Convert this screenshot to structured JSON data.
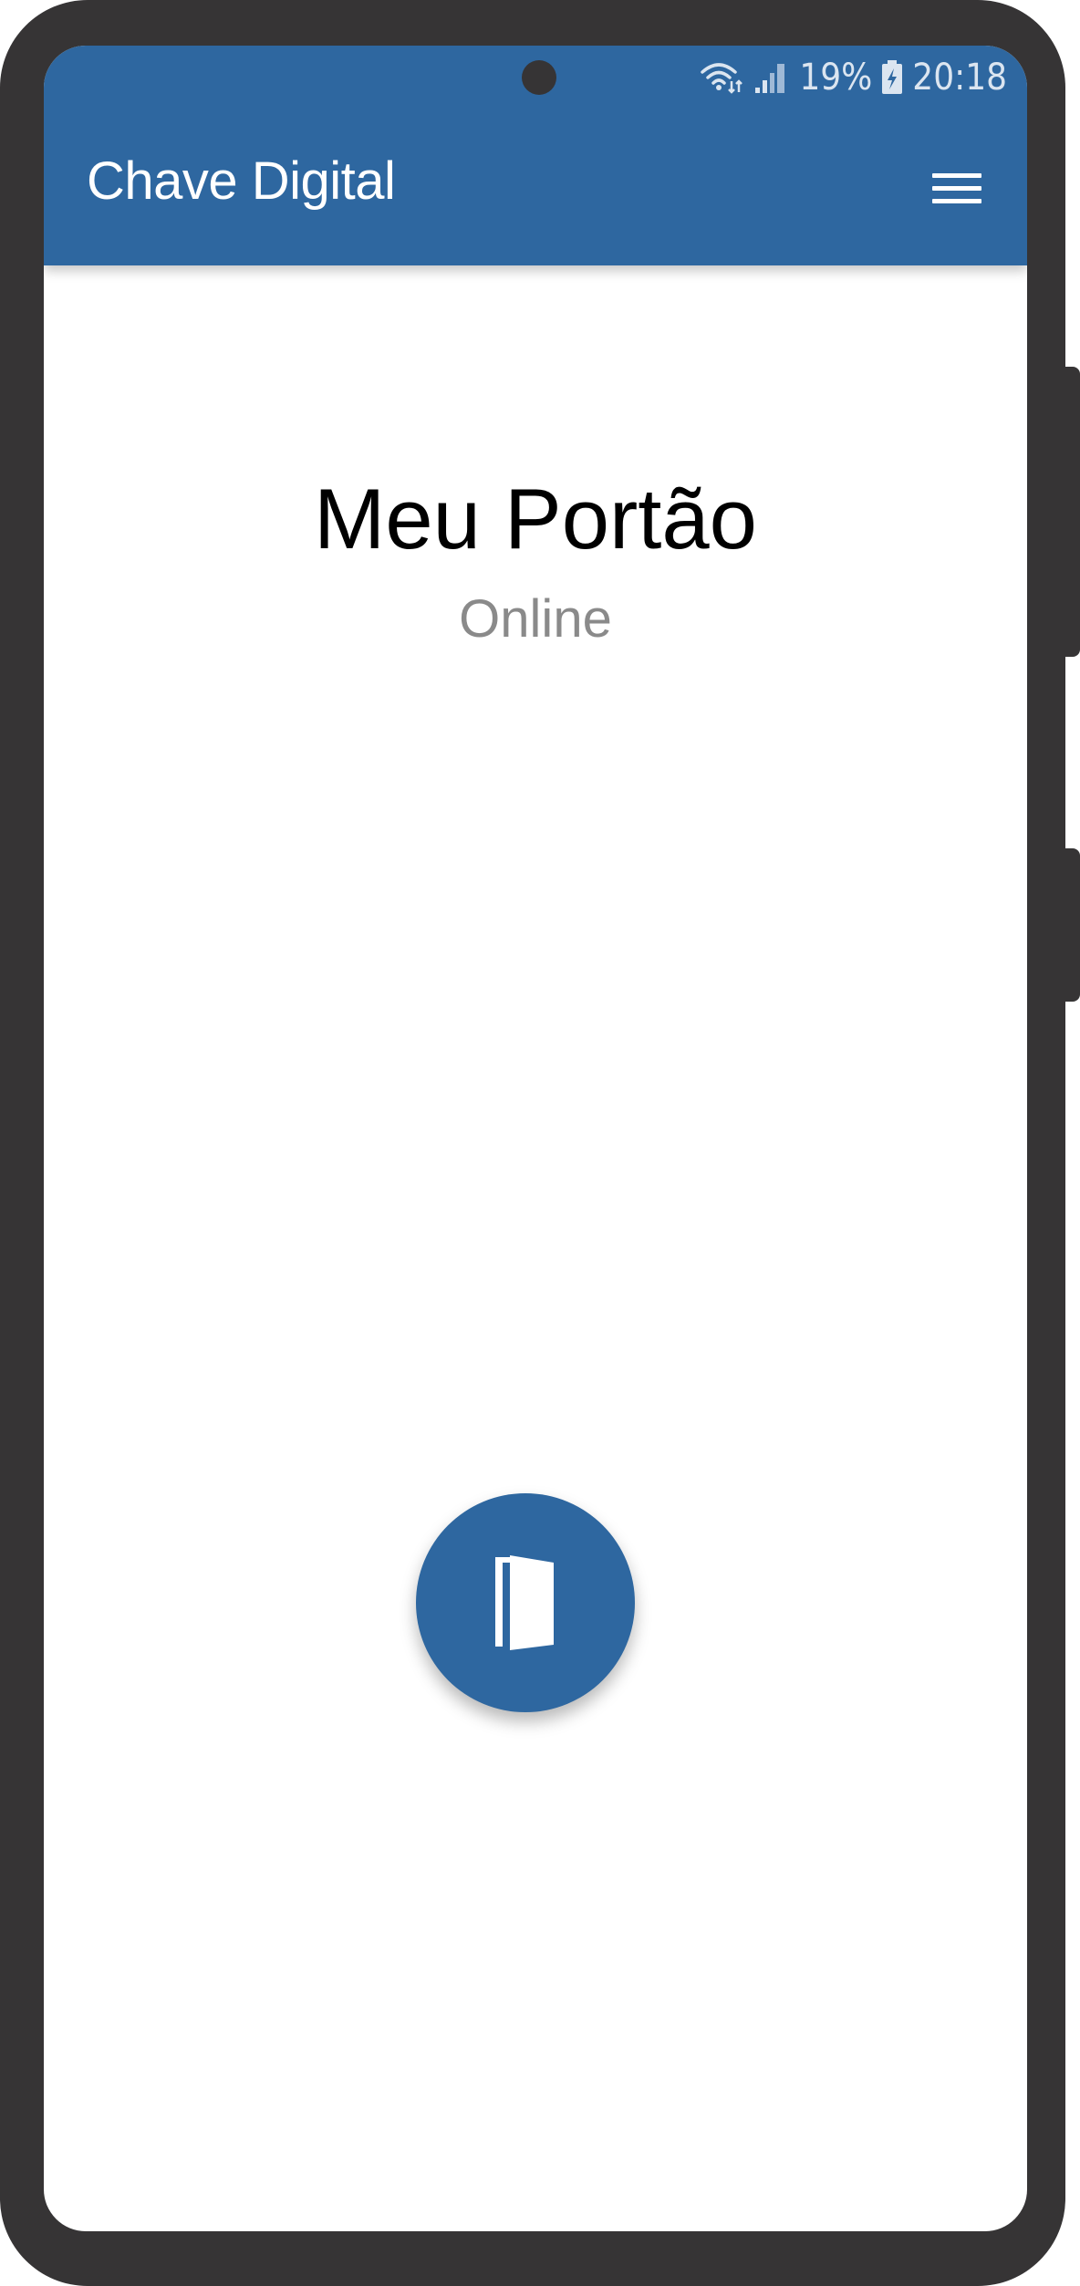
{
  "status_bar": {
    "battery_percent": "19%",
    "time": "20:18"
  },
  "appbar": {
    "title": "Chave Digital"
  },
  "device": {
    "name": "Meu Portão",
    "status": "Online"
  },
  "icons": {
    "menu": "hamburger-menu-icon",
    "action": "door-open-icon",
    "wifi": "wifi-icon",
    "signal": "cell-signal-icon",
    "battery": "battery-charging-icon"
  },
  "colors": {
    "primary": "#2e67a0",
    "frame": "#363435",
    "status_text": "#8a8a8a"
  }
}
